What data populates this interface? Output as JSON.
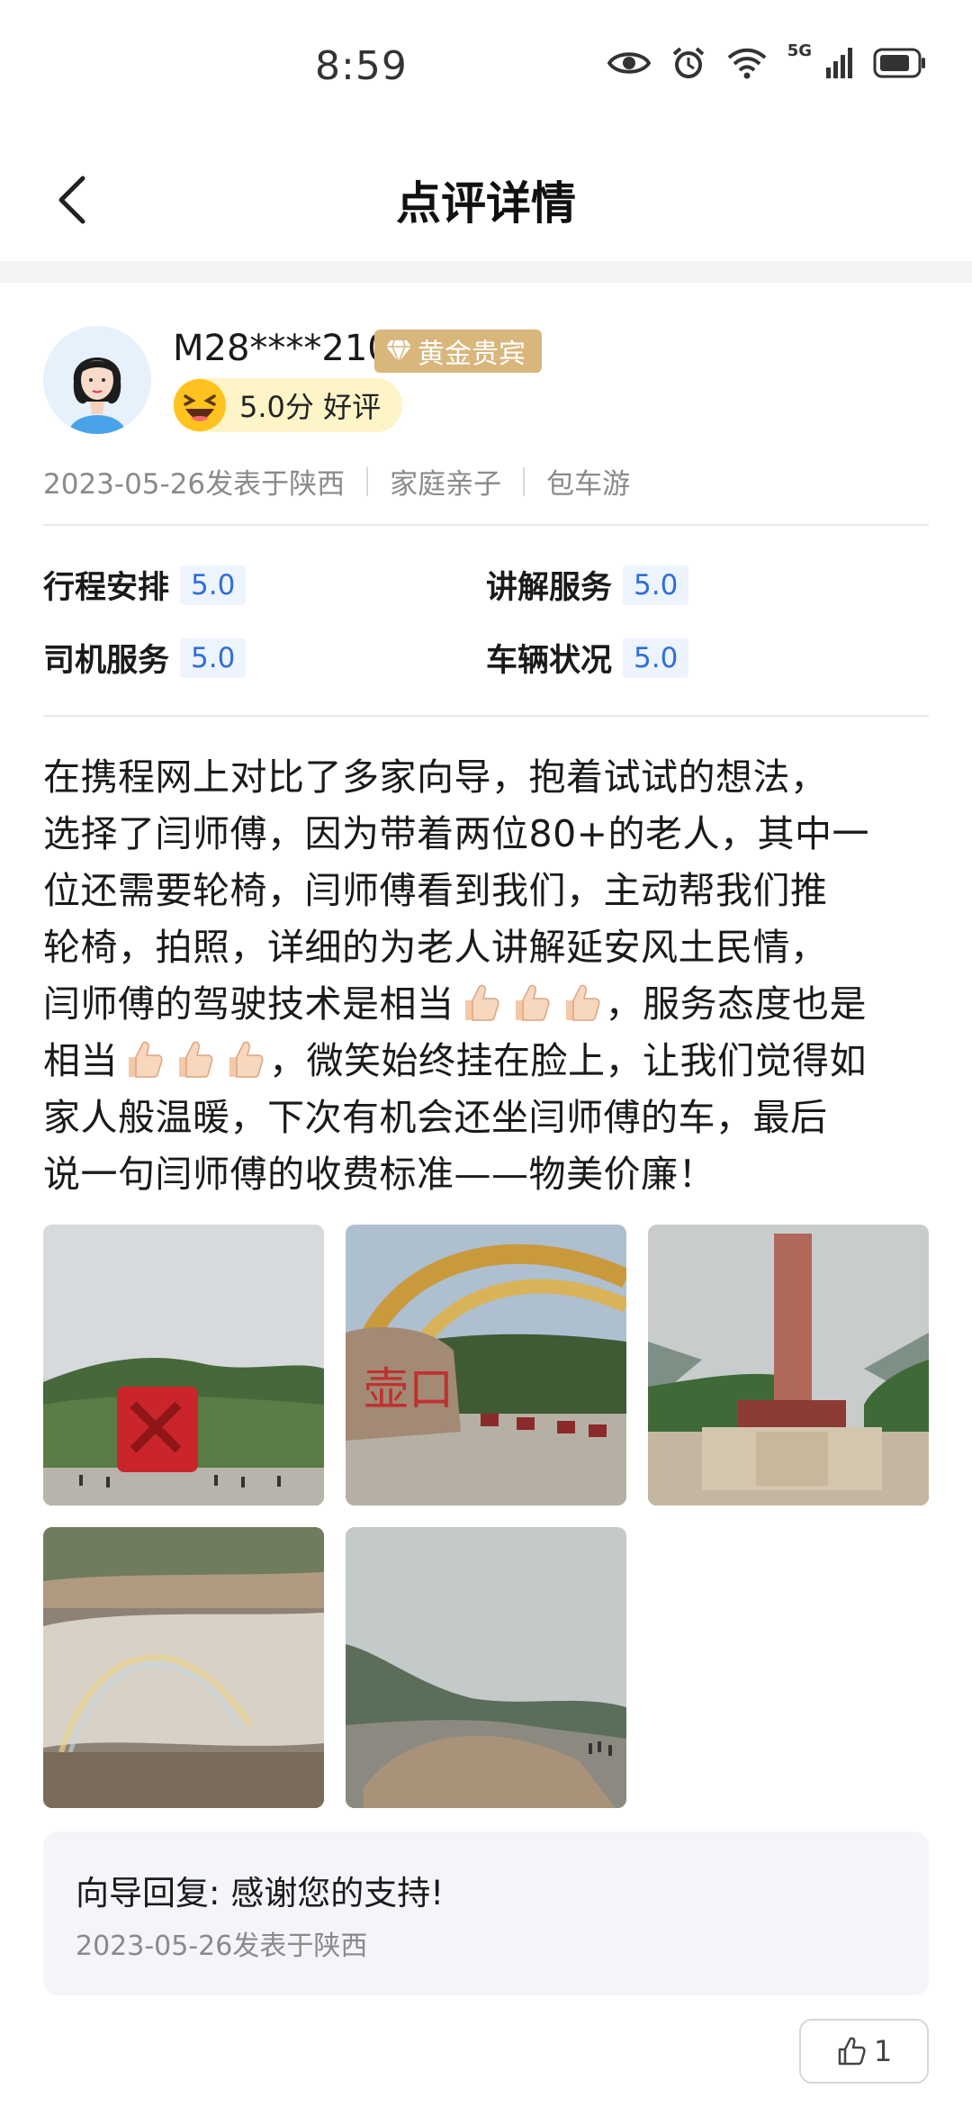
{
  "status_bar": {
    "time": "8:59",
    "network": "5G"
  },
  "nav": {
    "title": "点评详情"
  },
  "user": {
    "name": "M28****210",
    "badge": "黄金贵宾",
    "rating": "5.0分 好评"
  },
  "meta": {
    "date_location": "2023-05-26发表于陕西",
    "tag1": "家庭亲子",
    "tag2": "包车游"
  },
  "scores": [
    {
      "label": "行程安排",
      "value": "5.0"
    },
    {
      "label": "讲解服务",
      "value": "5.0"
    },
    {
      "label": "司机服务",
      "value": "5.0"
    },
    {
      "label": "车辆状况",
      "value": "5.0"
    }
  ],
  "review": {
    "line1": "在携程网上对比了多家向导，抱着试试的想法，",
    "line2": "选择了闫师傅，因为带着两位80+的老人，其中一",
    "line3": "位还需要轮椅，闫师傅看到我们，主动帮我们推",
    "line4": "轮椅，拍照，详细的为老人讲解延安风土民情，",
    "line5_a": "闫师傅的驾驶技术是相当",
    "line5_b": "，服务态度也是",
    "line6_a": "相当",
    "line6_b": "，微笑始终挂在脸上，让我们觉得如",
    "line7": "家人般温暖，下次有机会还坐闫师傅的车，最后",
    "line8": "说一句闫师傅的收费标准——物美价廉！"
  },
  "reply": {
    "text": "向导回复: 感谢您的支持!",
    "date": "2023-05-26发表于陕西"
  },
  "likes": {
    "count": "1"
  },
  "colors": {
    "accent": "#2f6fd6",
    "badge": "#d9b67c",
    "rating_bg": "#fdf4c8"
  }
}
